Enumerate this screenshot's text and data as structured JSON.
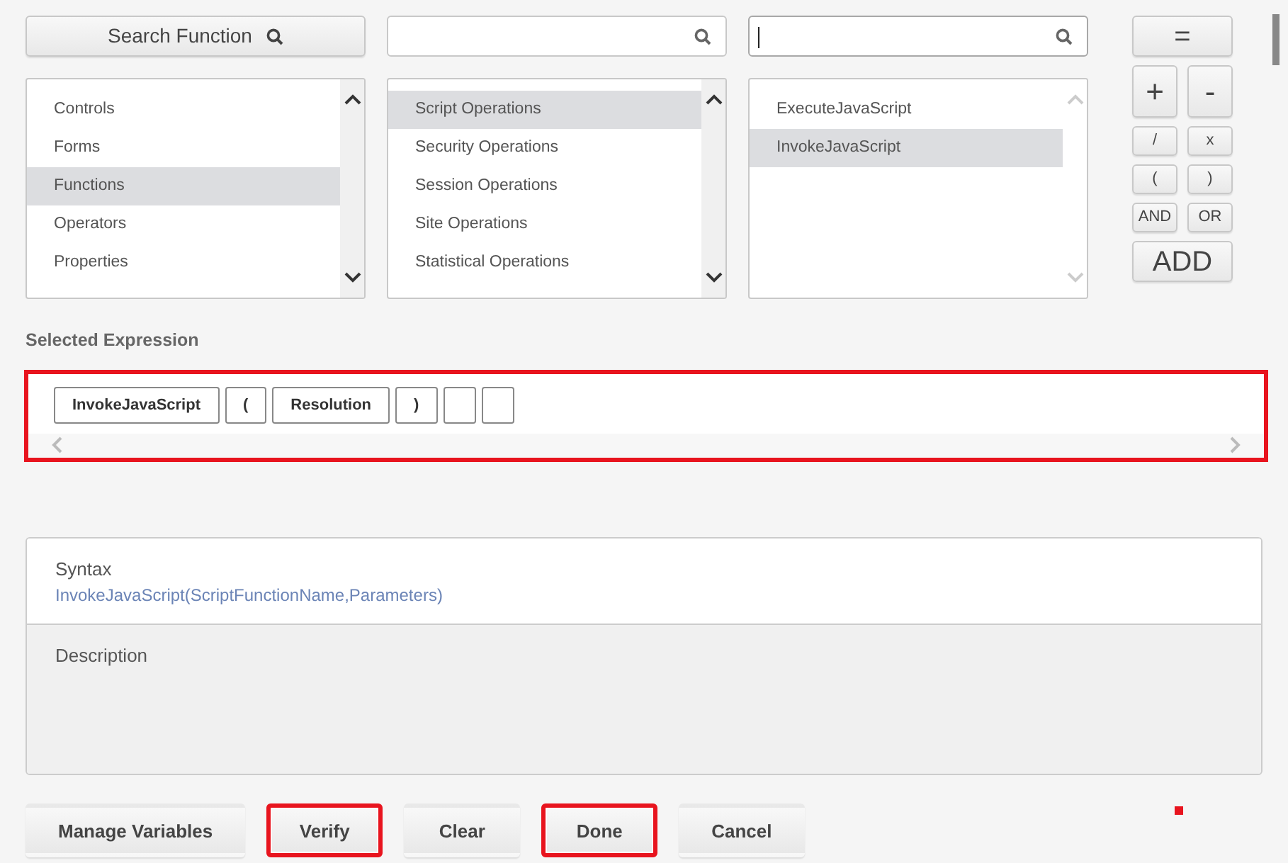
{
  "search_function_button": {
    "label": "Search Function"
  },
  "search_fields": [
    {
      "focused": false
    },
    {
      "focused": true
    }
  ],
  "lists": [
    {
      "scroll_enabled": true,
      "items": [
        {
          "label": "Controls",
          "selected": false
        },
        {
          "label": "Forms",
          "selected": false
        },
        {
          "label": "Functions",
          "selected": true
        },
        {
          "label": "Operators",
          "selected": false
        },
        {
          "label": "Properties",
          "selected": false
        }
      ]
    },
    {
      "scroll_enabled": true,
      "items": [
        {
          "label": "Script Operations",
          "selected": true
        },
        {
          "label": "Security Operations",
          "selected": false
        },
        {
          "label": "Session Operations",
          "selected": false
        },
        {
          "label": "Site Operations",
          "selected": false
        },
        {
          "label": "Statistical Operations",
          "selected": false
        }
      ]
    },
    {
      "scroll_enabled": false,
      "items": [
        {
          "label": "ExecuteJavaScript",
          "selected": false
        },
        {
          "label": "InvokeJavaScript",
          "selected": true
        }
      ]
    }
  ],
  "operators": [
    {
      "kind": "wide",
      "buttons": [
        "="
      ]
    },
    {
      "kind": "large",
      "buttons": [
        "+",
        "-"
      ]
    },
    {
      "kind": "small",
      "buttons": [
        "/",
        "x"
      ]
    },
    {
      "kind": "small",
      "buttons": [
        "(",
        ")"
      ]
    },
    {
      "kind": "small",
      "buttons": [
        "AND",
        "OR"
      ]
    },
    {
      "kind": "wide",
      "buttons": [
        "ADD"
      ]
    }
  ],
  "selected_expression": {
    "title": "Selected Expression",
    "highlighted": true,
    "tokens": [
      {
        "kind": "token",
        "label": "InvokeJavaScript"
      },
      {
        "kind": "token",
        "label": "("
      },
      {
        "kind": "token",
        "label": "Resolution"
      },
      {
        "kind": "token",
        "label": ")"
      },
      {
        "kind": "empty"
      },
      {
        "kind": "empty"
      }
    ]
  },
  "syntax": {
    "title": "Syntax",
    "text": "InvokeJavaScript(ScriptFunctionName,Parameters)"
  },
  "description": {
    "title": "Description"
  },
  "buttons": [
    {
      "label": "Manage Variables",
      "highlighted": false
    },
    {
      "label": "Verify",
      "highlighted": true
    },
    {
      "label": "Clear",
      "highlighted": false
    },
    {
      "label": "Done",
      "highlighted": true
    },
    {
      "label": "Cancel",
      "highlighted": false
    }
  ]
}
